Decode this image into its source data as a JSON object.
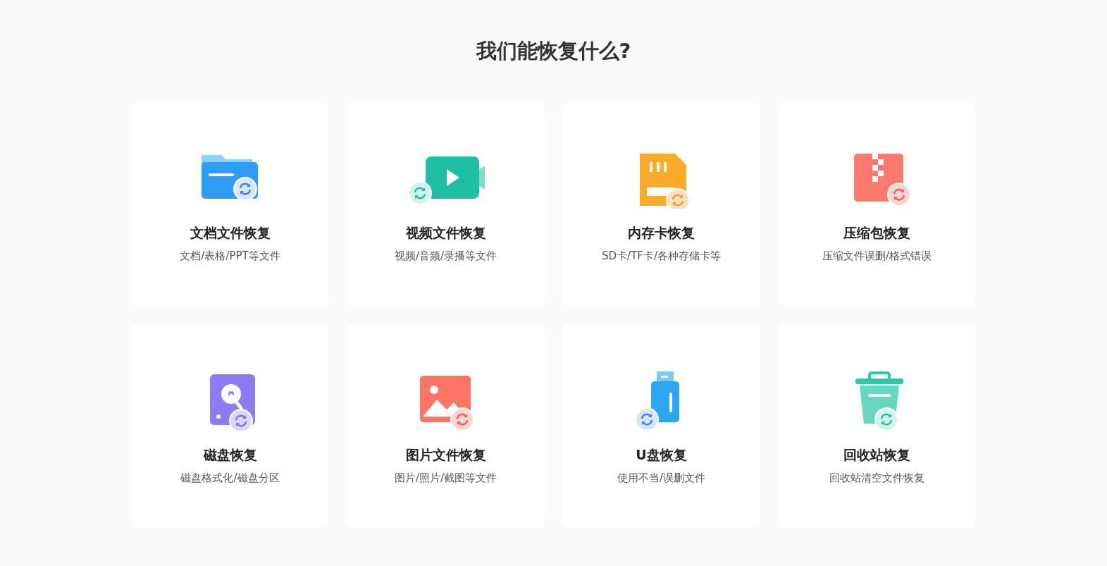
{
  "title": "我们能恢复什么?",
  "cards": [
    {
      "title": "文档文件恢复",
      "subtitle": "文档/表格/PPT等文件"
    },
    {
      "title": "视频文件恢复",
      "subtitle": "视频/音频/录播等文件"
    },
    {
      "title": "内存卡恢复",
      "subtitle": "SD卡/TF卡/各种存储卡等"
    },
    {
      "title": "压缩包恢复",
      "subtitle": "压缩文件误删/格式错误"
    },
    {
      "title": "磁盘恢复",
      "subtitle": "磁盘格式化/磁盘分区"
    },
    {
      "title": "图片文件恢复",
      "subtitle": "图片/照片/截图等文件"
    },
    {
      "title": "U盘恢复",
      "subtitle": "使用不当/误删文件"
    },
    {
      "title": "回收站恢复",
      "subtitle": "回收站清空文件恢复"
    }
  ]
}
